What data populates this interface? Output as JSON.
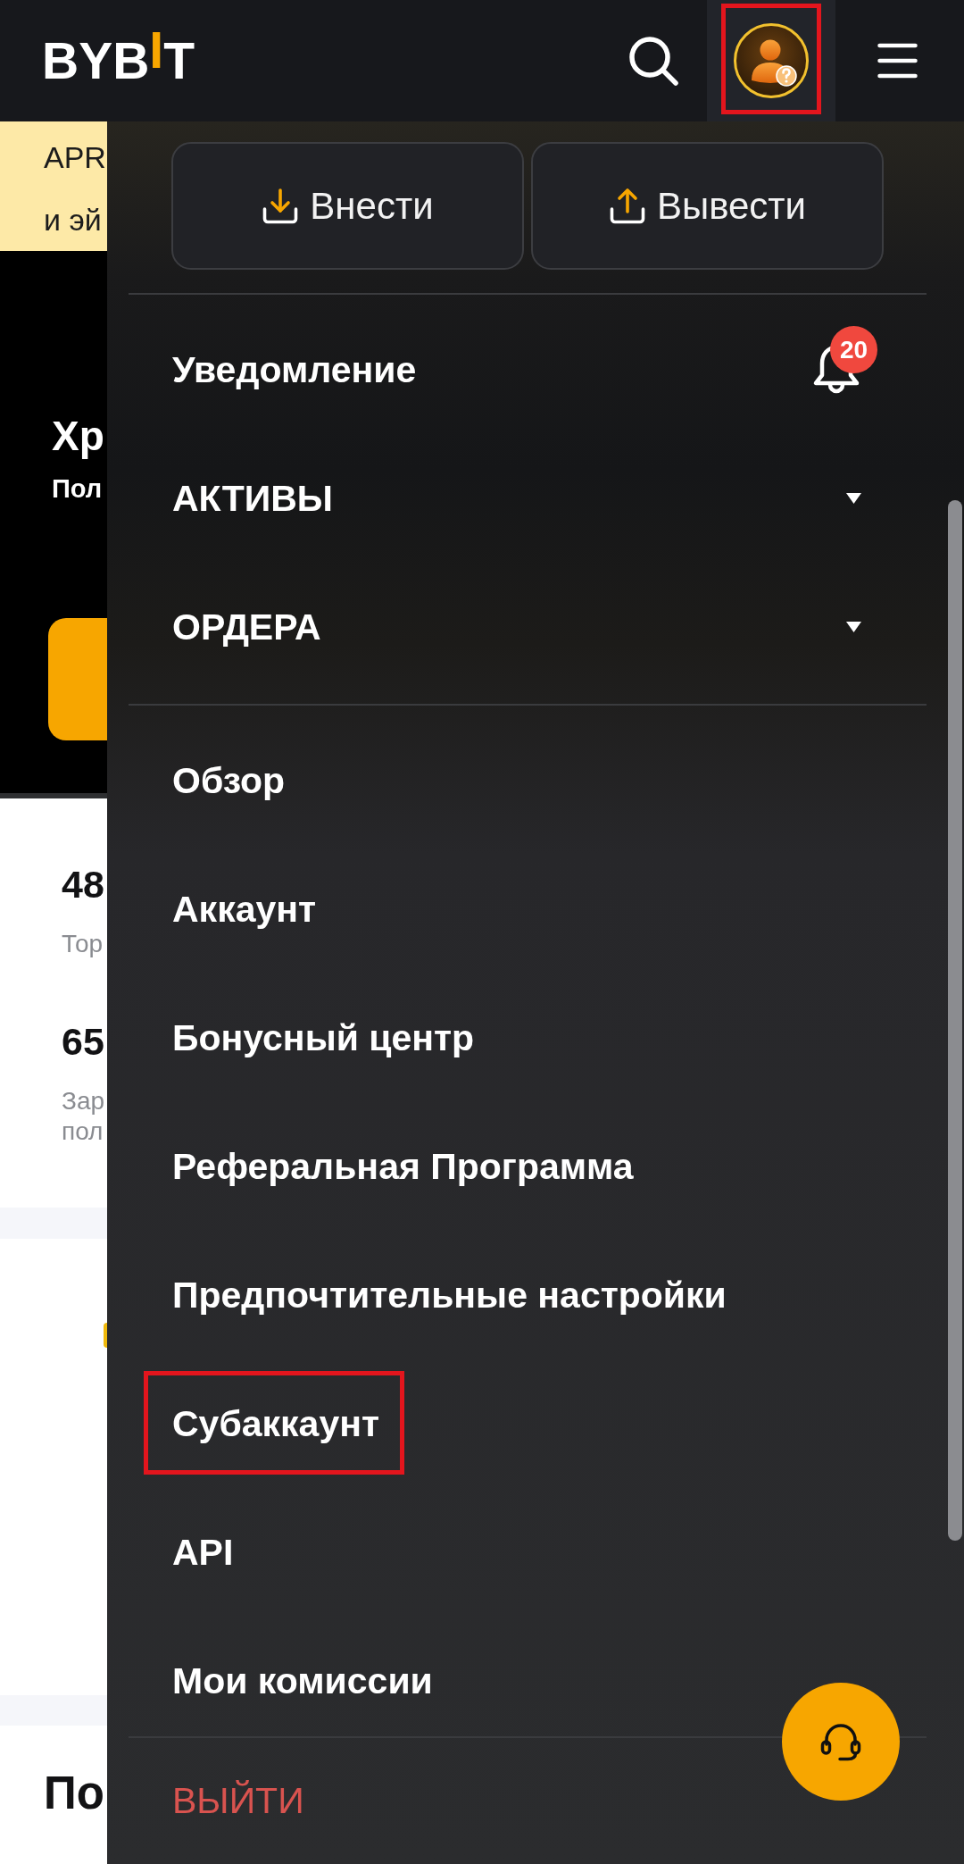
{
  "header": {
    "logo": "BYB$^{I}$T",
    "account_highlighted": true
  },
  "background_page": {
    "banner_lines": [
      "APR",
      "и эй"
    ],
    "hero": {
      "title": "Хр",
      "subtitle": "Пол"
    },
    "stats": [
      {
        "value": "48",
        "label_lines": [
          "Тор"
        ]
      },
      {
        "value": "65",
        "label_lines": [
          "Зар",
          "пол"
        ]
      }
    ],
    "section_title": "По"
  },
  "account_menu": {
    "actions": [
      {
        "kind": "deposit",
        "label": "Внести"
      },
      {
        "kind": "withdraw",
        "label": "Вывести"
      }
    ],
    "sections": [
      {
        "items": [
          {
            "kind": "notification",
            "label": "Уведомление",
            "badge": "20",
            "highlighted": false
          },
          {
            "kind": "dropdown",
            "label": "АКТИВЫ",
            "expanded": false,
            "highlighted": false
          },
          {
            "kind": "dropdown",
            "label": "ОРДЕРА",
            "expanded": false,
            "highlighted": false
          }
        ]
      },
      {
        "items": [
          {
            "kind": "link",
            "label": "Обзор",
            "highlighted": false
          },
          {
            "kind": "link",
            "label": "Аккаунт",
            "highlighted": false
          },
          {
            "kind": "link",
            "label": "Бонусный центр",
            "highlighted": false
          },
          {
            "kind": "link",
            "label": "Реферальная Программа",
            "highlighted": false
          },
          {
            "kind": "link",
            "label": "Предпочтительные настройки",
            "highlighted": false
          },
          {
            "kind": "link",
            "label": "Субаккаунт",
            "highlighted": true
          },
          {
            "kind": "link",
            "label": "API",
            "highlighted": false
          },
          {
            "kind": "link",
            "label": "Мои комиссии",
            "highlighted": false
          }
        ]
      },
      {
        "items": [
          {
            "kind": "logout",
            "label": "ВЫЙТИ",
            "highlighted": false
          }
        ]
      }
    ]
  }
}
